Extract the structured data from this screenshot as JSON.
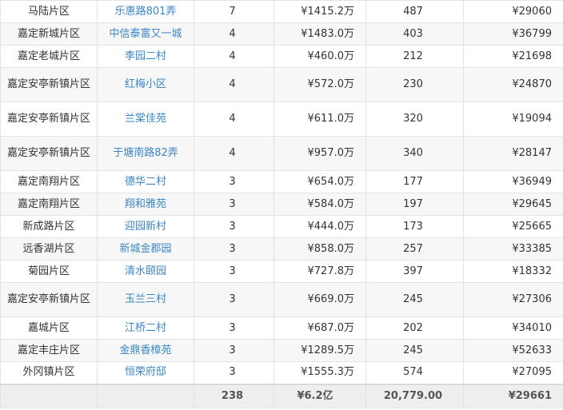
{
  "rows": [
    {
      "region": "马陆片区",
      "community": "乐惠路801弄",
      "count": "7",
      "total": "¥1415.2万",
      "area": "487",
      "price": "¥29060"
    },
    {
      "region": "嘉定新城片区",
      "community": "中信泰富又一城",
      "count": "4",
      "total": "¥1483.0万",
      "area": "403",
      "price": "¥36799"
    },
    {
      "region": "嘉定老城片区",
      "community": "李园二村",
      "count": "4",
      "total": "¥460.0万",
      "area": "212",
      "price": "¥21698"
    },
    {
      "region": "嘉定安亭新镇片区",
      "community": "红梅小区",
      "count": "4",
      "total": "¥572.0万",
      "area": "230",
      "price": "¥24870"
    },
    {
      "region": "嘉定安亭新镇片区",
      "community": "兰棠佳苑",
      "count": "4",
      "total": "¥611.0万",
      "area": "320",
      "price": "¥19094"
    },
    {
      "region": "嘉定安亭新镇片区",
      "community": "于塘南路82弄",
      "count": "4",
      "total": "¥957.0万",
      "area": "340",
      "price": "¥28147"
    },
    {
      "region": "嘉定南翔片区",
      "community": "德华二村",
      "count": "3",
      "total": "¥654.0万",
      "area": "177",
      "price": "¥36949"
    },
    {
      "region": "嘉定南翔片区",
      "community": "翔和雅苑",
      "count": "3",
      "total": "¥584.0万",
      "area": "197",
      "price": "¥29645"
    },
    {
      "region": "新成路片区",
      "community": "迎园新村",
      "count": "3",
      "total": "¥444.0万",
      "area": "173",
      "price": "¥25665"
    },
    {
      "region": "远香湖片区",
      "community": "新城金郡园",
      "count": "3",
      "total": "¥858.0万",
      "area": "257",
      "price": "¥33385"
    },
    {
      "region": "菊园片区",
      "community": "清水颐园",
      "count": "3",
      "total": "¥727.8万",
      "area": "397",
      "price": "¥18332"
    },
    {
      "region": "嘉定安亭新镇片区",
      "community": "玉兰三村",
      "count": "3",
      "total": "¥669.0万",
      "area": "245",
      "price": "¥27306"
    },
    {
      "region": "嘉城片区",
      "community": "江桥二村",
      "count": "3",
      "total": "¥687.0万",
      "area": "202",
      "price": "¥34010"
    },
    {
      "region": "嘉定丰庄片区",
      "community": "金鼎香樟苑",
      "count": "3",
      "total": "¥1289.5万",
      "area": "245",
      "price": "¥52633"
    },
    {
      "region": "外冈镇片区",
      "community": "恒荣府邸",
      "count": "3",
      "total": "¥1555.3万",
      "area": "574",
      "price": "¥27095"
    }
  ],
  "summary": {
    "region": "",
    "community": "",
    "count": "238",
    "total": "¥6.2亿",
    "area": "20,779.00",
    "price": "¥29661"
  }
}
